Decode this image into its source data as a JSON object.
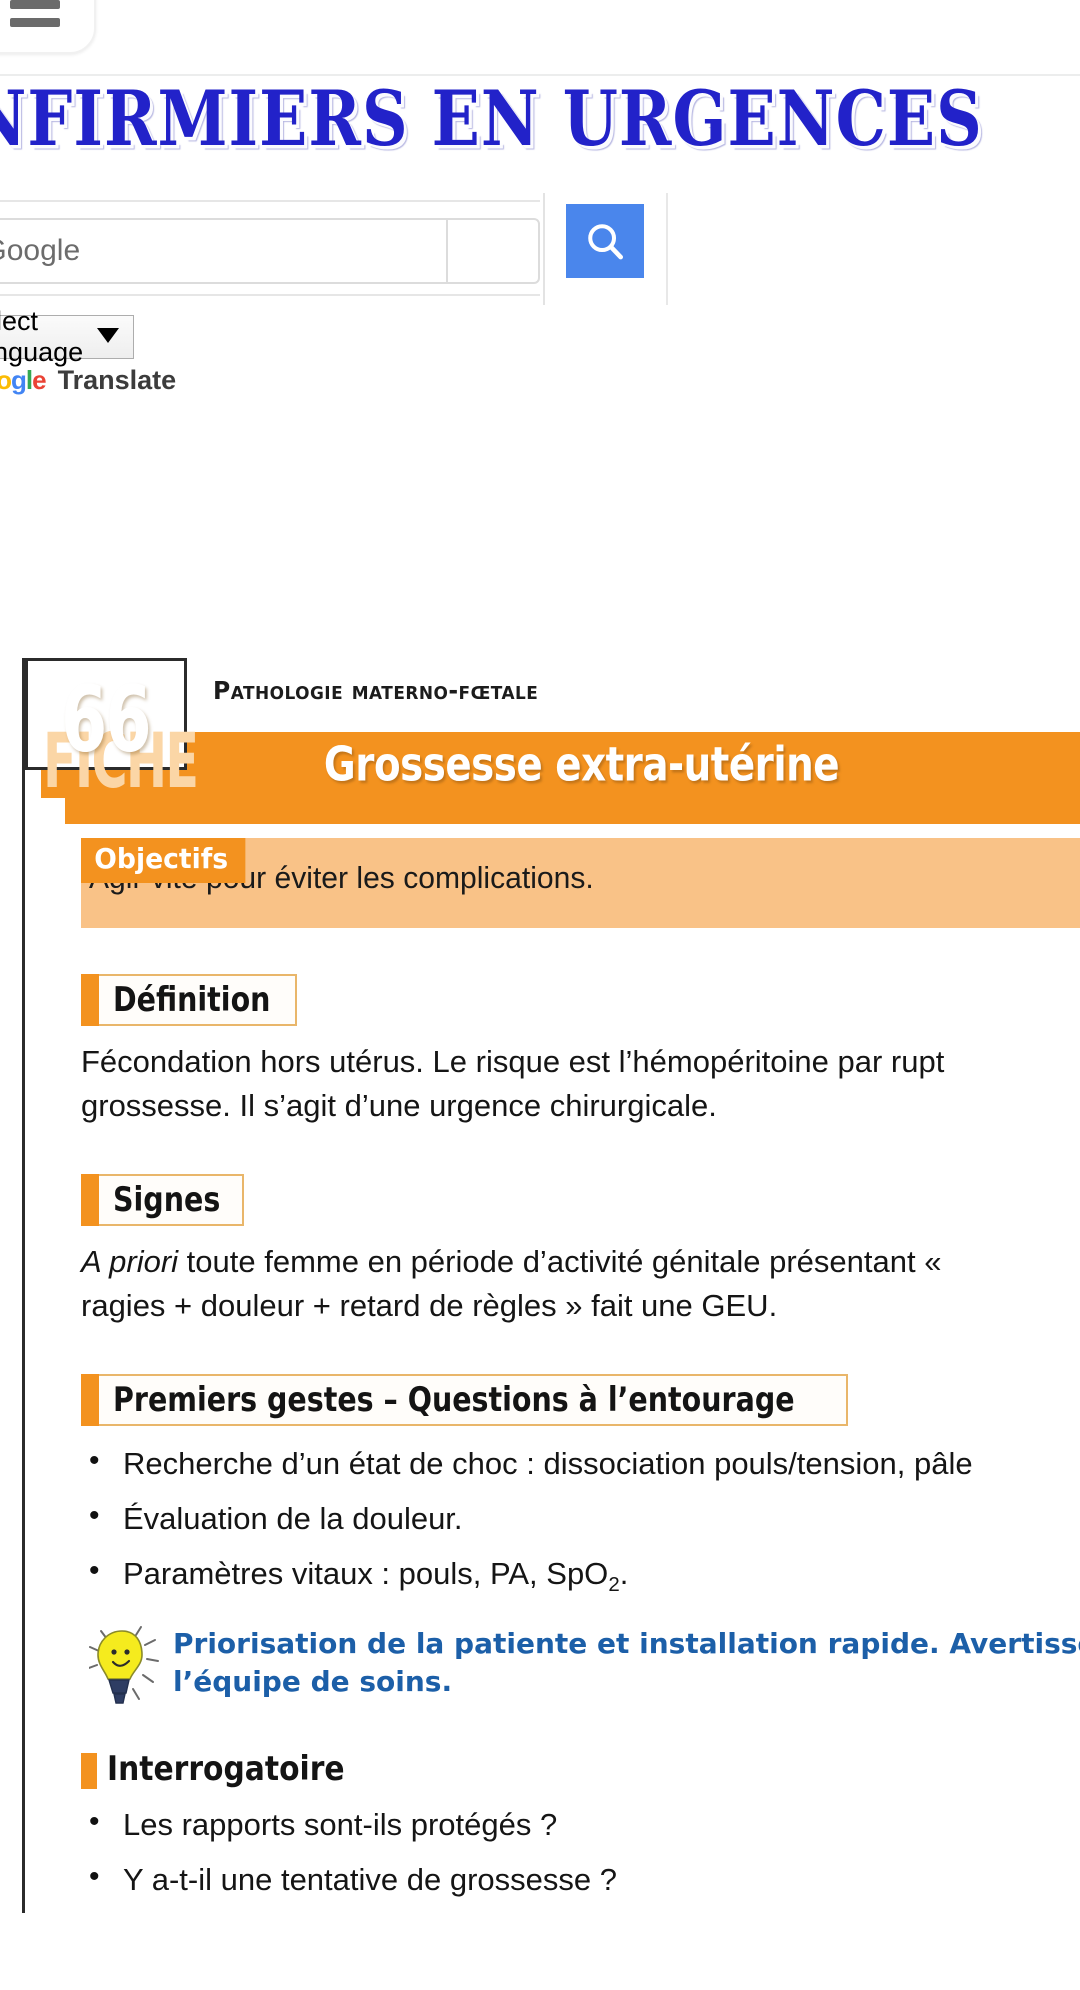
{
  "browser": {
    "menu_icon": "hamburger-menu-icon"
  },
  "site": {
    "banner_title": "INFIRMIERS EN URGENCES"
  },
  "search": {
    "placeholder": "Recherche Google",
    "value": "",
    "button_icon": "search-icon"
  },
  "translate": {
    "selected_language": "Select Language",
    "logo_letters": [
      "G",
      "o",
      "o",
      "g",
      "l",
      "e"
    ],
    "powered_label": "Translate"
  },
  "document": {
    "fiche_word": "FICHE",
    "fiche_number": "66",
    "kicker": "Pathologie materno-fœtale",
    "title": "Grossesse extra-utérine",
    "objectifs": {
      "tag": "Objectifs",
      "text": "Agir vite pour éviter les complications."
    },
    "sections": [
      {
        "heading": "Définition",
        "body_line_1_pre": "Fécondation hors utérus. Le risque est l’hémopéritoine par rupt",
        "body_line_2": "grossesse. Il s’agit d’une urgence chirurgicale."
      },
      {
        "heading": "Signes",
        "body_italic": "A priori",
        "body_line_1_post": " toute femme en période d’activité génitale présentant «",
        "body_line_2": "ragies + douleur + retard de règles » fait une GEU."
      },
      {
        "heading": "Premiers gestes – Questions à l’entourage",
        "bullets": [
          "Recherche d’un état de choc : dissociation pouls/tension, pâle",
          "Évaluation de la douleur.",
          "Paramètres vitaux : pouls, PA, SpO"
        ],
        "bullet_3_subscript": "2",
        "bullet_3_suffix": ".",
        "tip": {
          "icon": "lightbulb-icon",
          "text": "Priorisation de la patiente et installation rapide. Avertisse\nl’équipe de soins.",
          "color": "#1c5fa8"
        }
      }
    ],
    "subsection": {
      "heading": "Interrogatoire",
      "bullets": [
        "Les rapports sont-ils protégés ?",
        "Y a-t-il une tentative de grossesse ?"
      ]
    },
    "colors": {
      "accent_orange": "#f3921f",
      "light_orange": "#f9c287",
      "tip_blue": "#1c5fa8",
      "banner_blue": "#2222c9",
      "search_button_blue": "#4a86ec"
    }
  }
}
